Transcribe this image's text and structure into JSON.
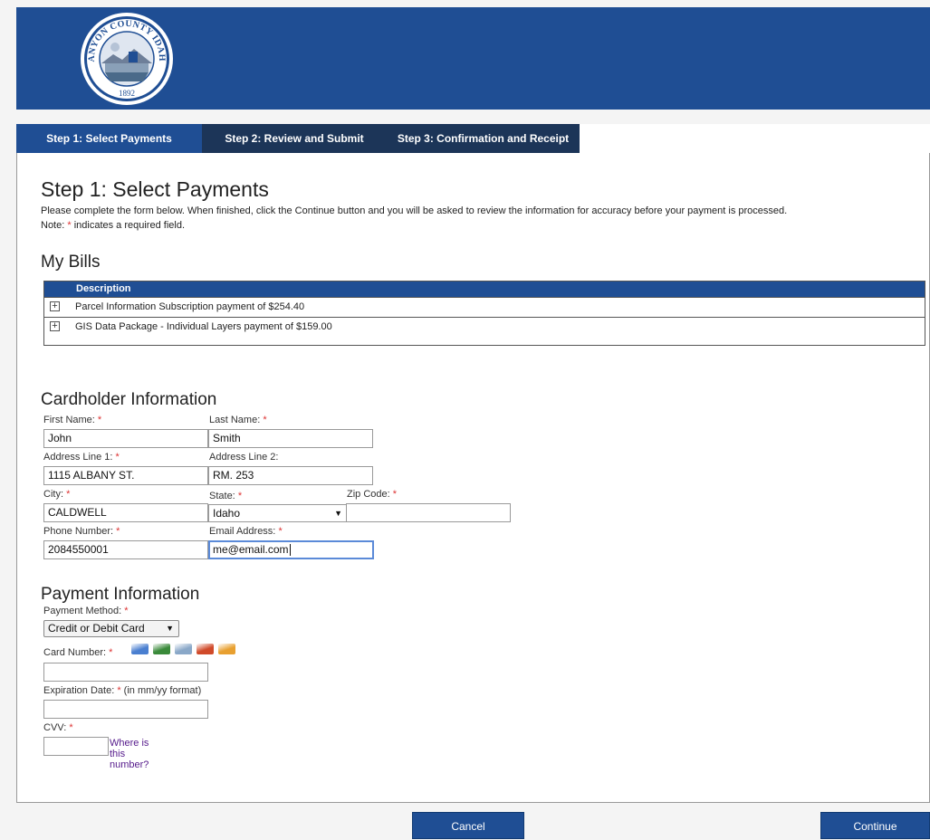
{
  "seal": {
    "name": "CANYON COUNTY IDAHO",
    "year": "1892"
  },
  "tabs": [
    {
      "label": "Step 1: Select Payments",
      "active": true
    },
    {
      "label": "Step 2: Review and Submit",
      "active": false
    },
    {
      "label": "Step 3: Confirmation and Receipt",
      "active": false
    }
  ],
  "page": {
    "title": "Step 1: Select Payments",
    "intro": "Please complete the form below. When finished, click the Continue button and you will be asked to review the information for accuracy before your payment is processed.",
    "note_prefix": "Note:",
    "note_star": "*",
    "note_suffix": "indicates a required field."
  },
  "bills": {
    "heading": "My Bills",
    "column": "Description",
    "expand_symbol": "+",
    "rows": [
      "Parcel Information Subscription payment of $254.40",
      "GIS Data Package - Individual Layers payment of $159.00"
    ]
  },
  "cardholder": {
    "heading": "Cardholder Information",
    "first_name_label": "First Name:",
    "first_name": "John",
    "last_name_label": "Last Name:",
    "last_name": "Smith",
    "address1_label": "Address Line 1:",
    "address1": "1115 ALBANY ST.",
    "address2_label": "Address Line 2:",
    "address2": "RM. 253",
    "city_label": "City:",
    "city": "CALDWELL",
    "state_label": "State:",
    "state": "Idaho",
    "zip_label": "Zip Code:",
    "zip": "",
    "phone_label": "Phone Number:",
    "phone": "2084550001",
    "email_label": "Email Address:",
    "email": "me@email.com",
    "required_mark": "*"
  },
  "payment": {
    "heading": "Payment Information",
    "method_label": "Payment Method:",
    "method": "Credit or Debit Card",
    "card_number_label": "Card Number:",
    "card_number": "",
    "expiration_label": "Expiration Date:",
    "expiration_hint": "(in mm/yy format)",
    "expiration": "",
    "cvv_label": "CVV:",
    "cvv": "",
    "cvv_help": "Where is this number?",
    "card_icon_colors": [
      "#4a7fd0",
      "#3a8a3a",
      "#8aa8c8",
      "#d04a2a",
      "#e8a030"
    ],
    "required_mark": "*"
  },
  "buttons": {
    "cancel": "Cancel",
    "continue": "Continue"
  },
  "colors": {
    "banner": "#1f4e94",
    "tab_inactive": "#1c3558",
    "required": "#dd3333"
  }
}
